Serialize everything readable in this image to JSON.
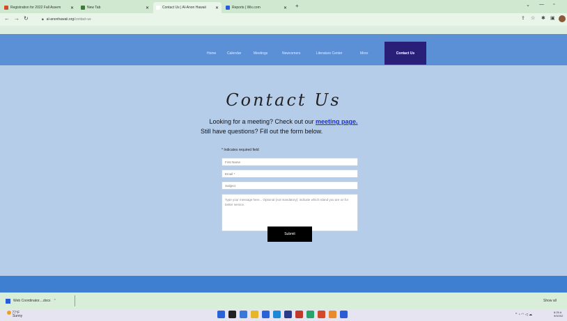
{
  "browser": {
    "tabs": [
      {
        "label": "Registration for 2022 Fall Assem",
        "favicon_color": "#d24a2a",
        "active": false
      },
      {
        "label": "New Tab",
        "favicon_color": "#3a7a3a",
        "active": false
      },
      {
        "label": "Contact Us | Al-Anon Hawaii",
        "favicon_color": "#ffffff",
        "active": true
      },
      {
        "label": "Reports | Wix.com",
        "favicon_color": "#2b5cd6",
        "active": false
      }
    ],
    "new_tab_glyph": "+",
    "url_host": "al-anonhawaii.org",
    "url_path": "/contact-us",
    "nav_icons": [
      "back-icon",
      "forward-icon",
      "reload-icon",
      "lock-icon"
    ]
  },
  "site_nav": {
    "items": [
      "Home",
      "Calendar",
      "Meetings",
      "Newcomers",
      "Literature Center",
      "More"
    ],
    "active": "Contact Us"
  },
  "page": {
    "title": "Contact Us",
    "line1_prefix": "Looking for a meeting?  Check out our ",
    "line1_link": "meeting page.",
    "line2": "Still have questions?  Fill out the form below."
  },
  "form": {
    "required_note": "* Indicates required field",
    "first_name_placeholder": "First Name",
    "email_placeholder": "Email *",
    "subject_placeholder": "Subject",
    "message_placeholder": "Type your message here... Optional (not mandatory): indicate which island you are on for better service.",
    "submit_label": "Submit"
  },
  "downloads": {
    "item": "Web Coordinator....docx",
    "show_all": "Show all"
  },
  "taskbar": {
    "weather_temp": "77°F",
    "weather_desc": "Sunny",
    "time": "8:25 A",
    "date": "9/9/202",
    "app_colors": [
      "#2a63d6",
      "#222222",
      "#3a78d8",
      "#e7b52a",
      "#2a63d6",
      "#1a8ad6",
      "#2a3b8a",
      "#c0392b",
      "#2aa36a",
      "#d24a2a",
      "#e98b2a",
      "#2b5cd6"
    ]
  }
}
